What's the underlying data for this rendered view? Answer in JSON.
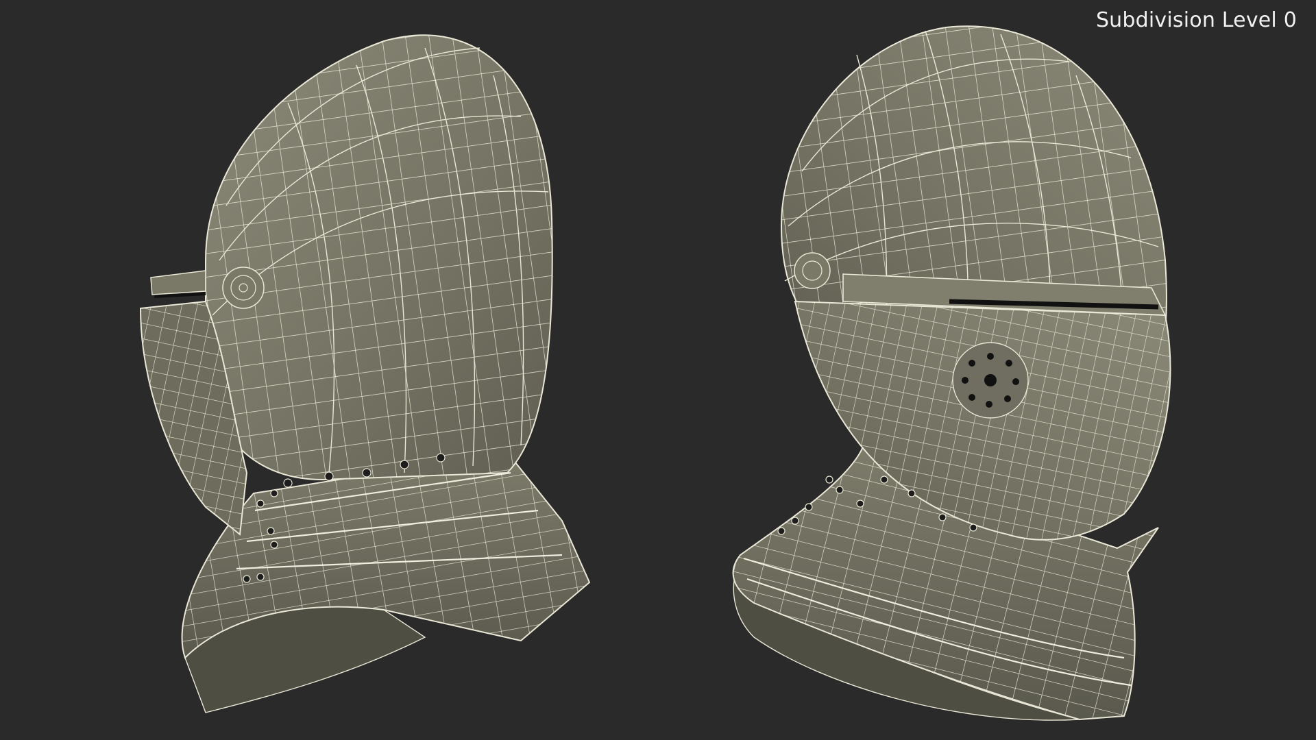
{
  "viewport": {
    "overlay_label": "Subdivision Level 0",
    "background": "#2a2a2a"
  },
  "scene": {
    "subject": "helmet-wireframe",
    "views": [
      "left-side-view",
      "three-quarter-front-view"
    ],
    "colors": {
      "surface": "#767565",
      "surface_dark": "#4f4e43",
      "wire": "#e9e7d6",
      "hole": "#111111"
    }
  }
}
